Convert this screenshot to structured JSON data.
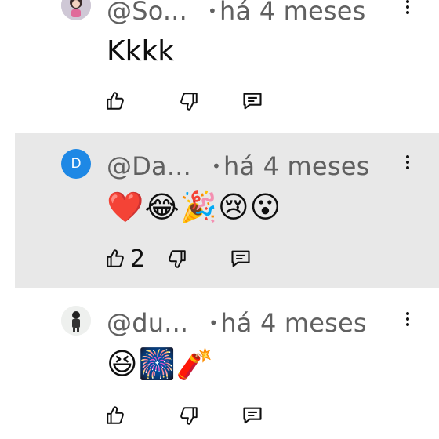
{
  "comments": [
    {
      "author": "@So...",
      "time": "há 4 meses",
      "text": "Kkkk",
      "likes": "",
      "avatar_icon": "avatar-girl-icon"
    },
    {
      "author": "@Da...",
      "time": "há 4 meses",
      "text": "❤️😂🎉😢😮",
      "likes": "2",
      "avatar_letter": "D",
      "avatar_color": "#1e88e5",
      "highlighted": true
    },
    {
      "author": "@du...",
      "time": "há 4 meses",
      "text": "😆🎆🧨",
      "likes": "",
      "avatar_icon": "avatar-person-icon"
    }
  ],
  "separator": "•",
  "colors": {
    "highlight_bg": "#e8e8e8",
    "meta_text": "#606060",
    "avatar_blue": "#1e88e5"
  }
}
